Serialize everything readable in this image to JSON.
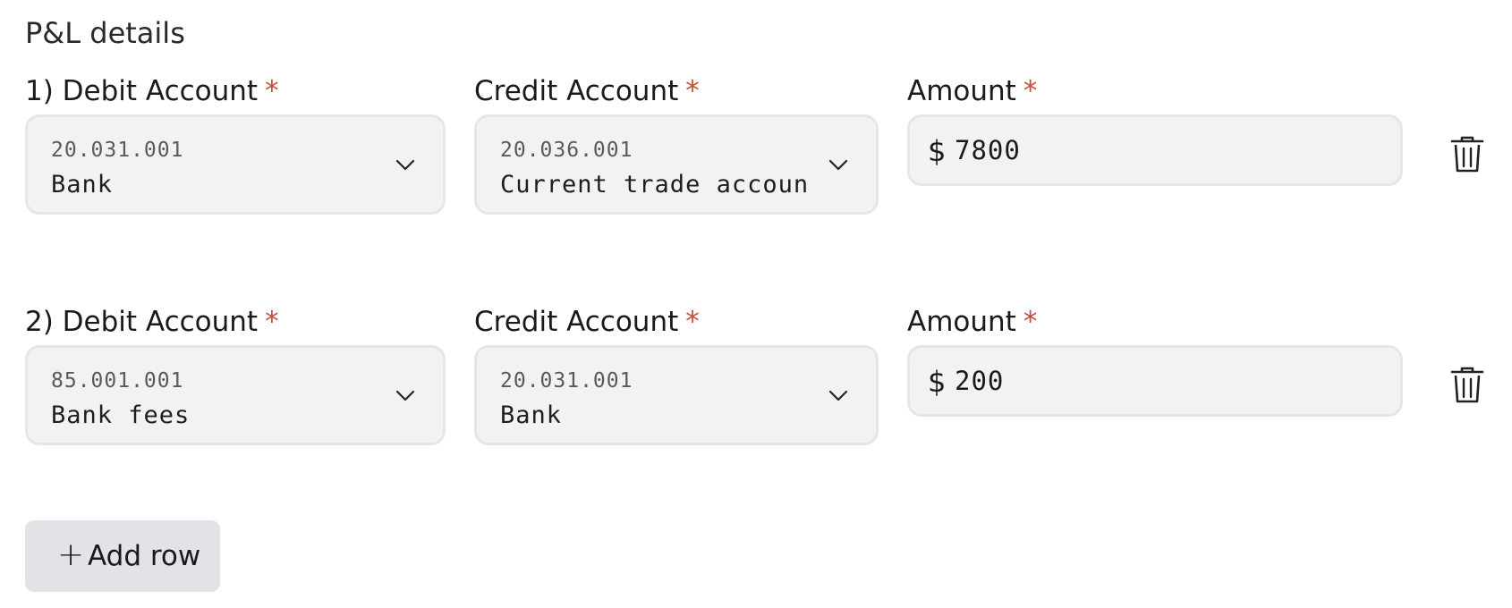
{
  "section": {
    "title": "P&L details"
  },
  "rows": [
    {
      "debit_label": "1) Debit Account",
      "credit_label": "Credit Account",
      "amount_label": "Amount",
      "required_mark": "*",
      "debit": {
        "code": "20.031.001",
        "name": "Bank"
      },
      "credit": {
        "code": "20.036.001",
        "name": "Current trade accoun"
      },
      "currency": "$",
      "amount": "7800"
    },
    {
      "debit_label": "2) Debit Account",
      "credit_label": "Credit Account",
      "amount_label": "Amount",
      "required_mark": "*",
      "debit": {
        "code": "85.001.001",
        "name": "Bank fees"
      },
      "credit": {
        "code": "20.031.001",
        "name": "Bank"
      },
      "currency": "$",
      "amount": "200"
    }
  ],
  "actions": {
    "add_row_plus": "+",
    "add_row_label": "Add row"
  },
  "icons": {
    "chevron": "chevron-down-icon",
    "delete": "trash-icon"
  },
  "colors": {
    "required": "#c0503a",
    "field_bg": "#f2f2f2",
    "button_bg": "#e2e3e6"
  }
}
